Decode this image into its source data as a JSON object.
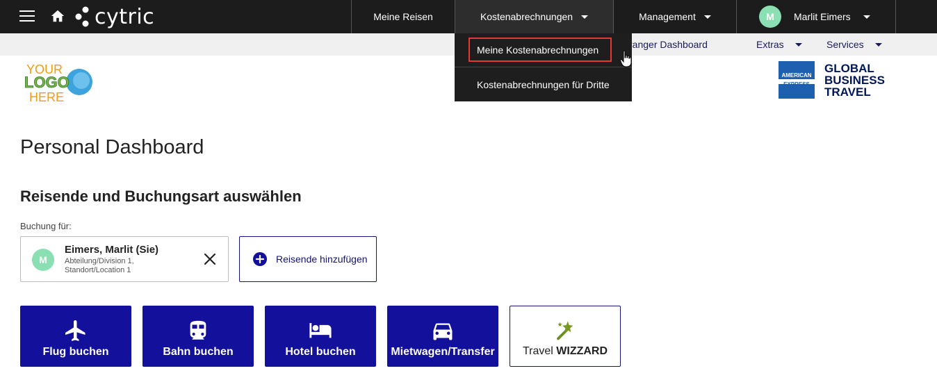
{
  "topbar": {
    "brand": "cytric",
    "nav": [
      {
        "label": "Meine Reisen"
      },
      {
        "label": "Kostenabrechnungen"
      },
      {
        "label": "Management"
      }
    ],
    "user": {
      "initial": "M",
      "name": "Marlit Eimers"
    }
  },
  "subnav": {
    "arranger": "vel Arranger Dashboard",
    "extras": "Extras",
    "services": "Services"
  },
  "dropdown": {
    "items": [
      {
        "label": "Meine Kostenabrechnungen"
      },
      {
        "label": "Kostenabrechnungen für Dritte"
      }
    ]
  },
  "logos": {
    "company": [
      "YOUR",
      "LOGO",
      "HERE"
    ],
    "amex_badge": [
      "AMERICAN",
      "EXPRESS"
    ],
    "amex_text": [
      "GLOBAL",
      "BUSINESS",
      "TRAVEL"
    ]
  },
  "main": {
    "page_title": "Personal Dashboard",
    "section_title": "Reisende und Buchungsart auswählen",
    "booking_for_label": "Buchung für:",
    "traveller": {
      "initial": "M",
      "name": "Eimers, Marlit (Sie)",
      "line1": "Abteilung/Division 1,",
      "line2": "Standort/Location 1"
    },
    "add_traveller": "Reisende hinzufügen",
    "tiles": {
      "flight": "Flug buchen",
      "rail": "Bahn buchen",
      "hotel": "Hotel buchen",
      "car": "Mietwagen/Transfer",
      "wizzard_prefix": "Travel",
      "wizzard_strong": "WIZZARD"
    }
  },
  "colors": {
    "topbar": "#1c1c1c",
    "primary": "#13109b",
    "avatar": "#8be0b3",
    "highlight": "#e53935"
  }
}
